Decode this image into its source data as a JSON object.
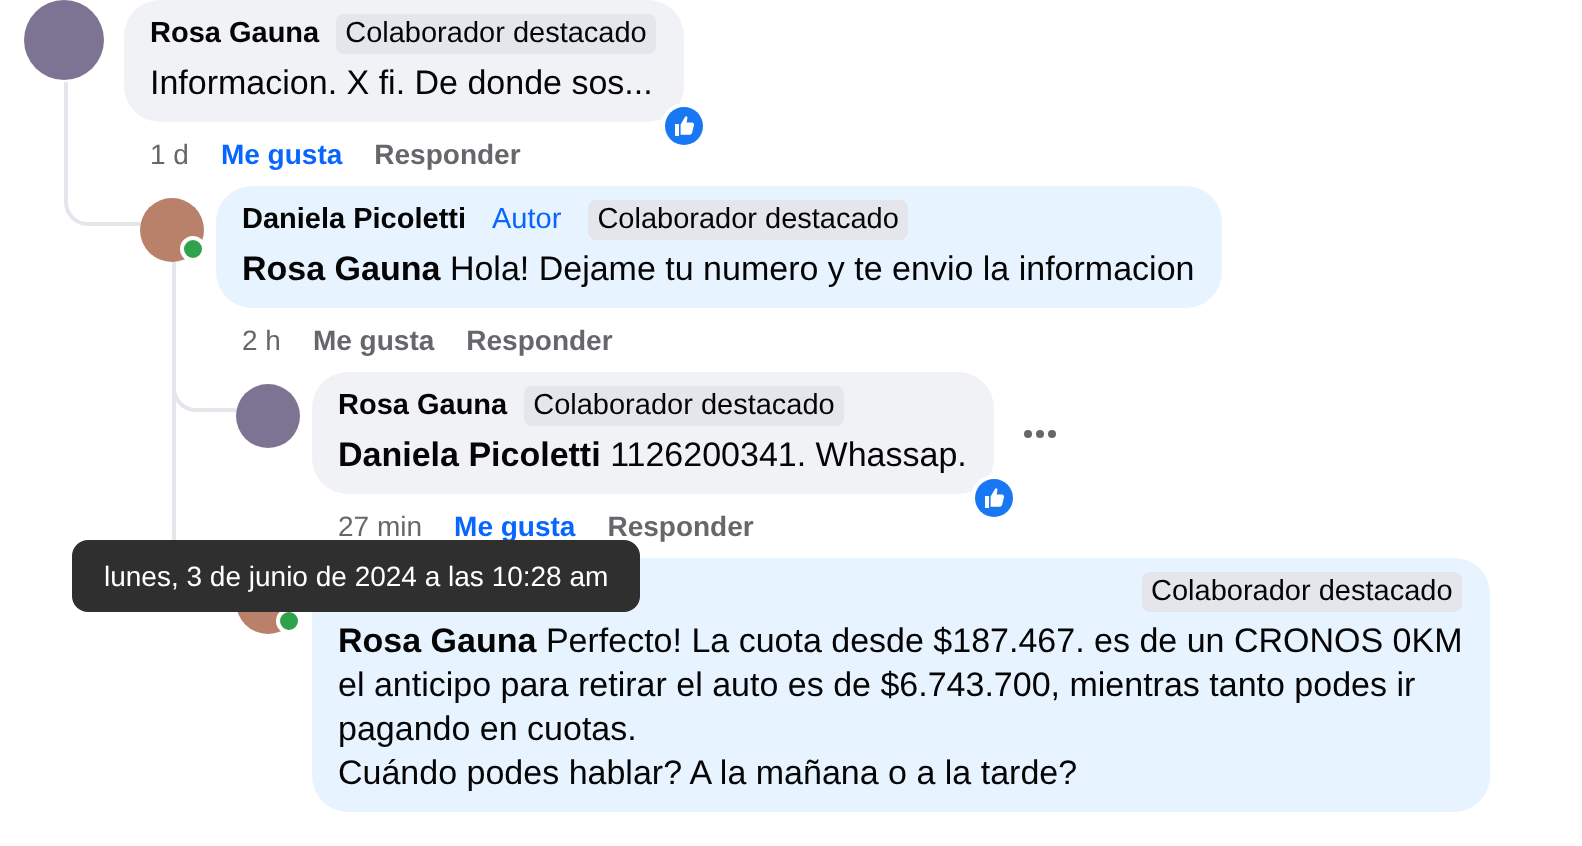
{
  "comments": [
    {
      "author": "Rosa Gauna",
      "badges": [
        {
          "kind": "top",
          "label": "Colaborador destacado"
        }
      ],
      "lines": [
        "Informacion. X fi. De donde sos..."
      ],
      "time": "1 d",
      "like": "Me gusta",
      "reply": "Responder",
      "liked": true,
      "reacted": true,
      "replies": [
        {
          "author": "Daniela Picoletti",
          "online": true,
          "badges": [
            {
              "kind": "author",
              "label": "Autor"
            },
            {
              "kind": "top",
              "label": "Colaborador destacado"
            }
          ],
          "mention": "Rosa Gauna",
          "lines": [
            "Hola! Dejame tu numero y te envio la informacion"
          ],
          "time": "2 h",
          "like": "Me gusta",
          "reply": "Responder",
          "liked": false,
          "replies": [
            {
              "author": "Rosa Gauna",
              "badges": [
                {
                  "kind": "top",
                  "label": "Colaborador destacado"
                }
              ],
              "mention": "Daniela Picoletti",
              "lines": [
                "1126200341. Whassap."
              ],
              "time": "27 min",
              "like": "Me gusta",
              "reply": "Responder",
              "liked": true,
              "reacted": true,
              "show_menu": true
            },
            {
              "online": true,
              "own": true,
              "badges": [
                {
                  "kind": "top",
                  "label": "Colaborador destacado"
                }
              ],
              "mention": "Rosa Gauna",
              "lines": [
                "Perfecto! La cuota desde $187.467. es de un CRONOS 0KM",
                "el anticipo para retirar el auto es de $6.743.700, mientras tanto podes ir",
                "pagando en cuotas.",
                "Cuándo podes hablar? A la mañana o a la tarde?"
              ]
            }
          ]
        }
      ]
    }
  ],
  "tooltip": {
    "text": "lunes, 3 de junio de 2024 a las 10:28 am"
  }
}
